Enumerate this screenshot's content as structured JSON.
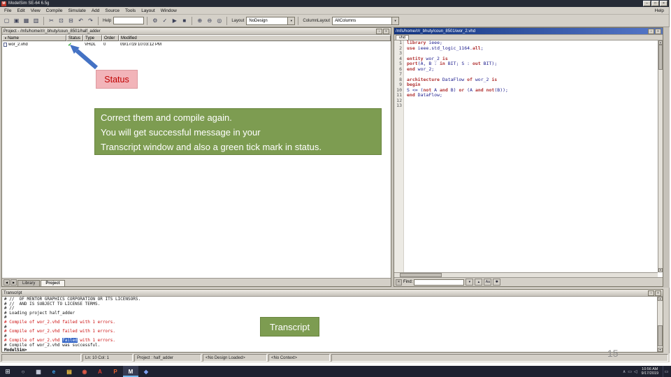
{
  "window": {
    "title": "ModelSim SE-64 6.5g",
    "app_icon": "M",
    "controls": [
      "–",
      "□",
      "×"
    ],
    "menus": [
      "File",
      "Edit",
      "View",
      "Compile",
      "Simulate",
      "Add",
      "Source",
      "Tools",
      "Layout",
      "Window"
    ],
    "help_menu": "Help"
  },
  "toolbar": {
    "icons_file": [
      {
        "name": "new-file-icon",
        "glyph": "▢"
      },
      {
        "name": "open-file-icon",
        "glyph": "▣"
      },
      {
        "name": "save-icon",
        "glyph": "▦"
      },
      {
        "name": "print-icon",
        "glyph": "▥"
      }
    ],
    "icons_edit": [
      {
        "name": "cut-icon",
        "glyph": "✂"
      },
      {
        "name": "copy-icon",
        "glyph": "⊡"
      },
      {
        "name": "paste-icon",
        "glyph": "⊟"
      },
      {
        "name": "undo-icon",
        "glyph": "↶"
      },
      {
        "name": "redo-icon",
        "glyph": "↷"
      }
    ],
    "help_label": "Help",
    "icons_compile": [
      {
        "name": "compile-icon",
        "glyph": "⚙"
      },
      {
        "name": "compile-all-icon",
        "glyph": "✓"
      },
      {
        "name": "simulate-icon",
        "glyph": "▶"
      },
      {
        "name": "break-icon",
        "glyph": "■"
      }
    ],
    "icons_view": [
      {
        "name": "zoom-in-icon",
        "glyph": "⊕"
      },
      {
        "name": "zoom-out-icon",
        "glyph": "⊖"
      },
      {
        "name": "zoom-full-icon",
        "glyph": "◎"
      }
    ],
    "layout_label": "Layout",
    "layout_value": "NoDesign",
    "column_layout_label": "ColumnLayout",
    "column_layout_value": "AllColumns",
    "dropdown_arrow": "▼"
  },
  "project_panel": {
    "title": "Project - /mfs/home/r/r_bhuty/coun_8501/half_adder",
    "header_buttons": [
      "▫",
      "×"
    ],
    "sort_indicator": "▼",
    "columns": [
      "Name",
      "Status",
      "Type",
      "Order",
      "Modified"
    ],
    "rows": [
      {
        "name": "wor_2.vhd",
        "status": "✓",
        "type": "VHDL",
        "order": "0",
        "modified": "09/17/19 10:03:12 PM"
      }
    ],
    "tab_arrows": [
      "◀",
      "▶"
    ],
    "tabs": [
      {
        "label": "Library",
        "active": false
      },
      {
        "label": "Project",
        "active": true
      }
    ]
  },
  "editor": {
    "title": "/mfs/home/r/r_bhuty/coun_8501/wor_2.vhd",
    "header_buttons": [
      "▫",
      "×"
    ],
    "tab_label": "vhd",
    "keywords": [
      "library",
      "use",
      "all",
      "entity",
      "is",
      "port",
      "in",
      "out",
      "end",
      "architecture",
      "of",
      "begin",
      "not",
      "and",
      "or"
    ],
    "code_lines": [
      "library ieee;",
      "use ieee.std_logic_1164.all;",
      "",
      "entity wor_2 is",
      "port(A, B : in BIT; S : out BIT);",
      "end wor_2;",
      "",
      "architecture DataFlow of wor_2 is",
      "begin",
      "S <= (not A and B) or (A and not(B));",
      "end DataFlow;",
      "",
      ""
    ],
    "find": {
      "close": "×",
      "label": "Find:",
      "value": "",
      "buttons": [
        "▾",
        "▴",
        "Aa",
        "✱"
      ]
    }
  },
  "transcript": {
    "title": "Transcript",
    "header_buttons": [
      "▫",
      "×"
    ],
    "lines": [
      {
        "text": "# //  OF MENTOR GRAPHICS CORPORATION OR ITS LICENSORS.",
        "type": "normal"
      },
      {
        "text": "# //  AND IS SUBJECT TO LICENSE TERMS.",
        "type": "normal"
      },
      {
        "text": "# //",
        "type": "normal"
      },
      {
        "text": "# Loading project half_adder",
        "type": "normal"
      },
      {
        "text": "#",
        "type": "normal"
      },
      {
        "text": "# Compile of wor_2.vhd failed with 1 errors.",
        "type": "error"
      },
      {
        "text": "#",
        "type": "normal"
      },
      {
        "text": "# Compile of wor_2.vhd failed with 1 errors.",
        "type": "error"
      },
      {
        "text": "#",
        "type": "normal"
      },
      {
        "text": "# Compile of wor_2.vhd failed with 1 errors.",
        "type": "error",
        "highlight": "failed"
      },
      {
        "text": "# Compile of wor_2.vhd was successful.",
        "type": "normal"
      },
      {
        "text": "ModelSim>",
        "type": "prompt"
      }
    ]
  },
  "statusbar": {
    "line_col": "Ln: 10 Col: 1",
    "project": "Project : half_adder",
    "design": "<No Design Loaded>",
    "context": "<No Context>"
  },
  "annotations": {
    "status_label": "Status",
    "callout_line1": "Correct them and compile again.",
    "callout_line2": "You will get successful message in your",
    "callout_line3": "Transcript window and also a green tick mark in status.",
    "transcript_label": "Transcript",
    "slide_number": "15",
    "arrow_color": "#4472c4",
    "green": "#7d9c51",
    "pink": "#f2b4b9",
    "red_text": "#c00000"
  },
  "taskbar": {
    "start_glyph": "⊞",
    "icons": [
      {
        "name": "search-icon",
        "glyph": "○",
        "color": "#c9cede"
      },
      {
        "name": "task-view-icon",
        "glyph": "▦",
        "color": "#c9cede"
      },
      {
        "name": "edge-browser-icon",
        "glyph": "e",
        "color": "#3fa9f5"
      },
      {
        "name": "file-explorer-icon",
        "glyph": "▤",
        "color": "#f5c542"
      },
      {
        "name": "chrome-icon",
        "glyph": "◉",
        "color": "#e05a47"
      },
      {
        "name": "acrobat-icon",
        "glyph": "A",
        "color": "#e23b2e"
      },
      {
        "name": "powerpoint-icon",
        "glyph": "P",
        "color": "#e8622c"
      },
      {
        "name": "modelsim-icon",
        "glyph": "M",
        "color": "#ffffff",
        "active": true
      },
      {
        "name": "questa-icon",
        "glyph": "◆",
        "color": "#7f9ff0"
      }
    ],
    "tray_icons": [
      {
        "name": "tray-expand-icon",
        "glyph": "∧"
      },
      {
        "name": "network-icon",
        "glyph": "▭"
      },
      {
        "name": "volume-icon",
        "glyph": "◁"
      }
    ],
    "time": "10:56 AM",
    "date": "9/17/2019",
    "notification_glyph": "▭"
  }
}
